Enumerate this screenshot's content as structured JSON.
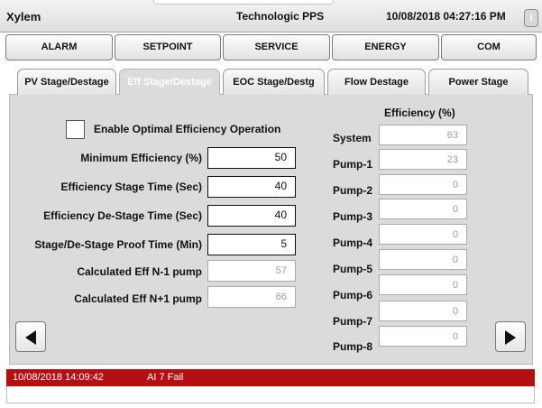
{
  "header": {
    "title": "Xylem",
    "subtitle": "Technologic PPS",
    "datetime": "10/08/2018 04:27:16 PM",
    "info_label": "i"
  },
  "nav": [
    "ALARM",
    "SETPOINT",
    "SERVICE",
    "ENERGY",
    "COM"
  ],
  "tabs": [
    {
      "label": "PV Stage/Destage"
    },
    {
      "label": "Eff Stage/Destage"
    },
    {
      "label": "EOC Stage/Destg"
    },
    {
      "label": "Flow Destage"
    },
    {
      "label": "Power Stage"
    }
  ],
  "optimal": {
    "label": "Enable Optimal Efficiency Operation",
    "checked": false
  },
  "settings": [
    {
      "label": "Minimum Efficiency (%)",
      "value": "50"
    },
    {
      "label": "Efficiency Stage Time (Sec)",
      "value": "40"
    },
    {
      "label": "Efficiency De-Stage Time (Sec)",
      "value": "40"
    },
    {
      "label": "Stage/De-Stage Proof Time (Min)",
      "value": "5"
    }
  ],
  "calculated": [
    {
      "label": "Calculated Eff N-1 pump",
      "value": "57"
    },
    {
      "label": "Calculated Eff N+1 pump",
      "value": "66"
    }
  ],
  "efficiency": {
    "header": "Efficiency (%)",
    "rows": [
      {
        "label": "System",
        "value": "63"
      },
      {
        "label": "Pump-1",
        "value": "23"
      },
      {
        "label": "Pump-2",
        "value": "0"
      },
      {
        "label": "Pump-3",
        "value": "0"
      },
      {
        "label": "Pump-4",
        "value": "0"
      },
      {
        "label": "Pump-5",
        "value": "0"
      },
      {
        "label": "Pump-6",
        "value": "0"
      },
      {
        "label": "Pump-7",
        "value": "0"
      },
      {
        "label": "Pump-8",
        "value": "0"
      }
    ]
  },
  "alarm": {
    "time": "10/08/2018 14:09:42",
    "text": "AI 7 Fail",
    "color": "#b50f14"
  },
  "icons": {
    "prev": "triangle-left-icon",
    "next": "triangle-right-icon",
    "info": "info-icon"
  }
}
